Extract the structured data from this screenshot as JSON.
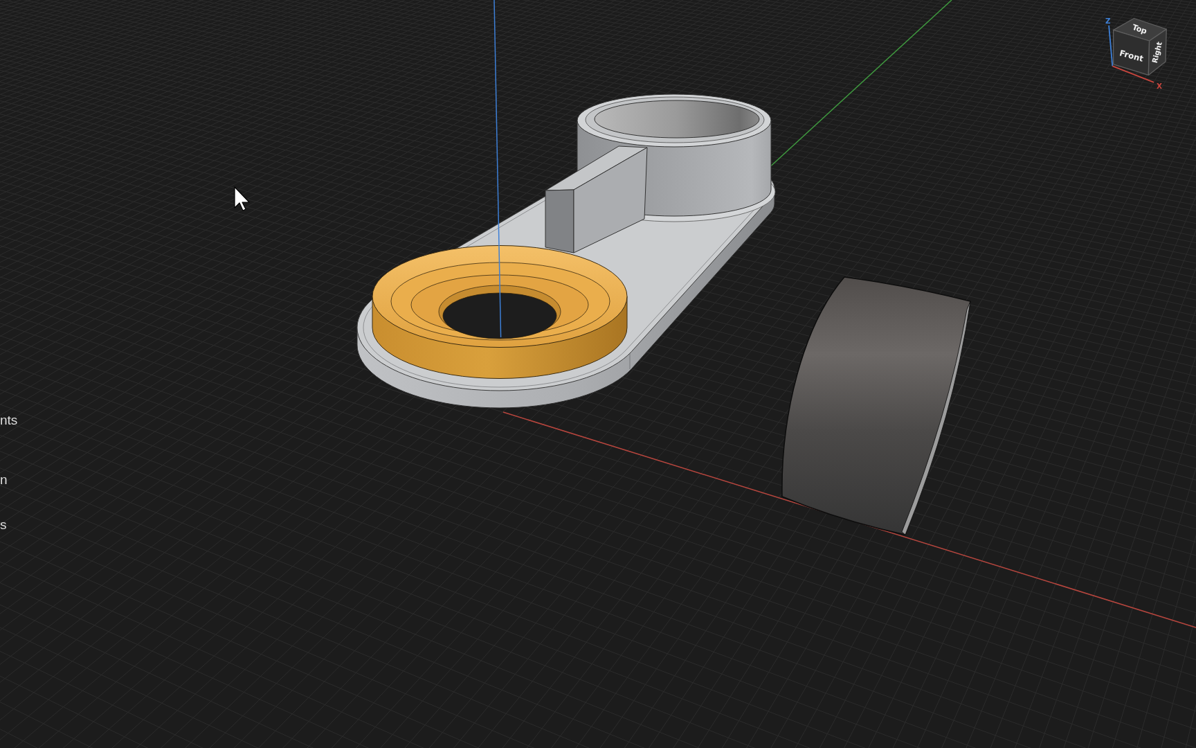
{
  "side_panel": {
    "items": [
      {
        "label": "nts"
      },
      {
        "label": "n"
      },
      {
        "label": "s"
      }
    ]
  },
  "view_cube": {
    "faces": [
      {
        "kind": "top",
        "label": "Top"
      },
      {
        "kind": "front",
        "label": "Front"
      },
      {
        "kind": "right",
        "label": "Right"
      }
    ],
    "axes": [
      {
        "kind": "z",
        "label": "Z"
      },
      {
        "kind": "x",
        "label": "X"
      }
    ]
  }
}
